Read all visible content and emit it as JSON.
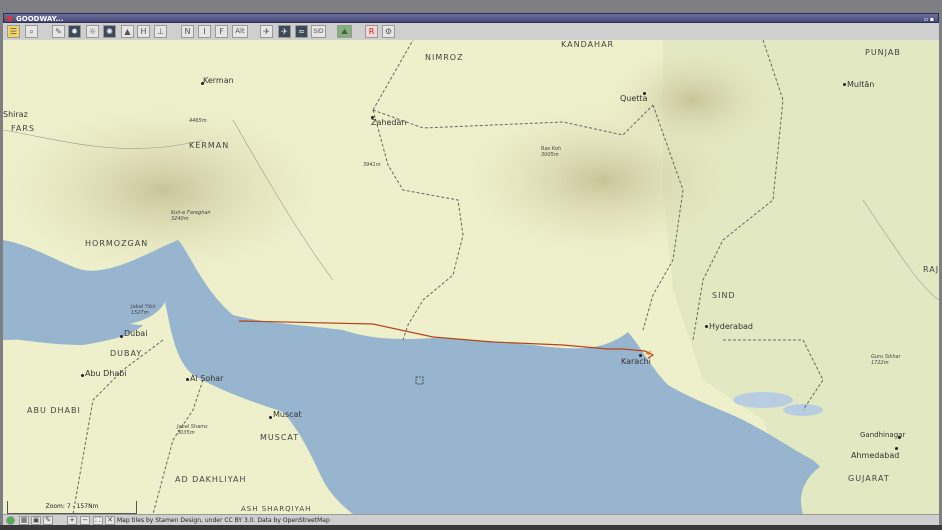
{
  "window": {
    "title": "GOODWAY..."
  },
  "toolbar": {
    "buttons": [
      {
        "name": "layers-button",
        "icon": "layers-icon",
        "label": ""
      },
      {
        "name": "search-button",
        "icon": "search-icon",
        "label": ""
      },
      {
        "name": "pencil-button",
        "icon": "pencil-icon",
        "label": ""
      },
      {
        "name": "sun-button",
        "icon": "sun-icon",
        "label": ""
      },
      {
        "name": "weather-button",
        "icon": "weather-icon",
        "label": ""
      },
      {
        "name": "satellite-button",
        "icon": "satellite-icon",
        "label": ""
      },
      {
        "name": "triangle-button",
        "icon": "triangle-icon",
        "label": ""
      },
      {
        "name": "heading-button",
        "icon": "",
        "label": "H"
      },
      {
        "name": "track-button",
        "icon": "track-icon",
        "label": ""
      },
      {
        "name": "north-button",
        "icon": "",
        "label": "N"
      },
      {
        "name": "info-button",
        "icon": "",
        "label": "I"
      },
      {
        "name": "fuel-button",
        "icon": "",
        "label": "F"
      },
      {
        "name": "altitude-button",
        "icon": "",
        "label": "Alt"
      },
      {
        "name": "aircraft-button",
        "icon": "airplane-icon",
        "label": ""
      },
      {
        "name": "departure-button",
        "icon": "departure-icon",
        "label": ""
      },
      {
        "name": "route-button",
        "icon": "route-icon",
        "label": ""
      },
      {
        "name": "sid-button",
        "icon": "",
        "label": "SID"
      },
      {
        "name": "terrain-button",
        "icon": "terrain-icon",
        "label": ""
      },
      {
        "name": "airport-button",
        "icon": "airport-icon",
        "label": ""
      },
      {
        "name": "settings-button",
        "icon": "gear-icon",
        "label": ""
      }
    ]
  },
  "map": {
    "regions": [
      "KANDAHAR",
      "NIMROZ",
      "PUNJAB",
      "FARS",
      "KERMAN",
      "HORMOZGAN",
      "SIND",
      "DUBAY",
      "ABU DHABI",
      "MUSCAT",
      "AD DAKHLIYAH",
      "GUJARAT",
      "RAJ",
      "ASH SHARQIYAH"
    ],
    "cities": [
      "Shiraz",
      "Kerman",
      "Zahedan",
      "Quetta",
      "Multān",
      "Dubai",
      "Abu Dhabi",
      "Al Sohar",
      "Muscat",
      "Karachi",
      "Hyderabad",
      "Gandhinagar",
      "Ahmedabad"
    ],
    "peaks": [
      {
        "name": "",
        "elev": "4465m"
      },
      {
        "name": "",
        "elev": "3941m"
      },
      {
        "name": "Ras Koh",
        "elev": "3005m"
      },
      {
        "name": "Kuh-e Fareghan",
        "elev": "3240m"
      },
      {
        "name": "Jabal Yibir",
        "elev": "1527m"
      },
      {
        "name": "Jabal Shams",
        "elev": "3035m"
      },
      {
        "name": "Guru Sikhar",
        "elev": "1722m"
      }
    ],
    "zoom_label": "Zoom: 7 - 157Nm",
    "colors": {
      "sea": "#98b5cf",
      "land": "#eef0cc",
      "route": "#b5441b"
    }
  },
  "statusbar": {
    "attribution": "Map tiles by Stamen Design, under CC BY 3.0. Data by OpenStreetMap",
    "buttons": [
      {
        "name": "status-online-icon"
      },
      {
        "name": "status-grid-icon"
      },
      {
        "name": "status-window-icon"
      },
      {
        "name": "status-pen-icon"
      },
      {
        "name": "zoom-in-button",
        "label": "+"
      },
      {
        "name": "zoom-out-button",
        "label": "−"
      },
      {
        "name": "fit-button",
        "label": ""
      },
      {
        "name": "close-map-button",
        "label": "✕"
      }
    ]
  }
}
